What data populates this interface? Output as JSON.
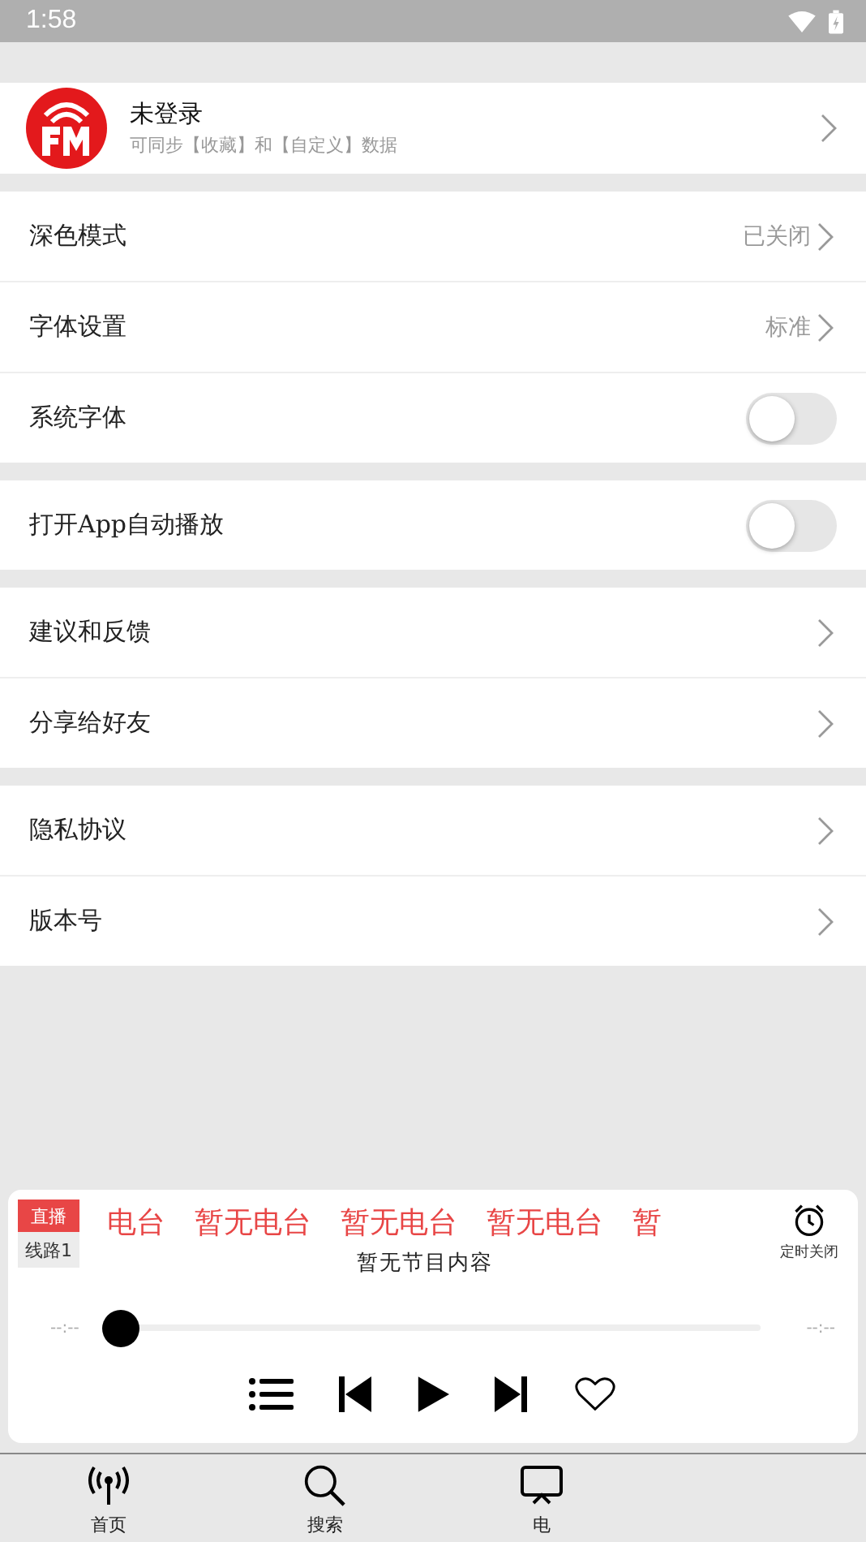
{
  "status_bar": {
    "time": "1:58"
  },
  "profile": {
    "title": "未登录",
    "subtitle": "可同步【收藏】和【自定义】数据"
  },
  "sections": [
    [
      {
        "kind": "link",
        "label": "深色模式",
        "value": "已关闭"
      },
      {
        "kind": "link",
        "label": "字体设置",
        "value": "标准"
      },
      {
        "kind": "toggle",
        "label": "系统字体",
        "on": false
      }
    ],
    [
      {
        "kind": "toggle",
        "label": "打开App自动播放",
        "on": false
      }
    ],
    [
      {
        "kind": "link",
        "label": "建议和反馈"
      },
      {
        "kind": "link",
        "label": "分享给好友"
      }
    ],
    [
      {
        "kind": "link",
        "label": "隐私协议"
      },
      {
        "kind": "link",
        "label": "版本号"
      }
    ]
  ],
  "player": {
    "badge": "直播",
    "line": "线路1",
    "marquee": [
      "电台",
      "暂无电台",
      "暂无电台",
      "暂无电台",
      "暂"
    ],
    "timer_label": "定时关闭",
    "program": "暂无节目内容",
    "elapsed": "--:--",
    "total": "--:--",
    "level": 0
  },
  "nav": [
    {
      "label": "首页"
    },
    {
      "label": "搜索"
    },
    {
      "label": "电"
    }
  ]
}
